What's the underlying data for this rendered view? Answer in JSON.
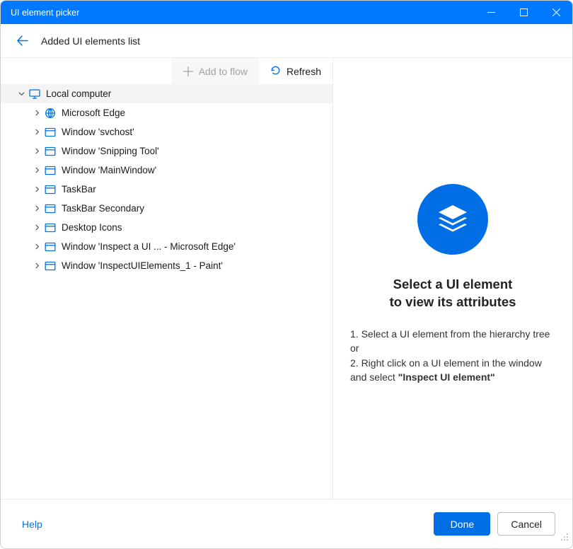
{
  "window": {
    "title": "UI element picker"
  },
  "header": {
    "title": "Added UI elements list"
  },
  "toolbar": {
    "add_label": "Add to flow",
    "refresh_label": "Refresh"
  },
  "tree": {
    "root_label": "Local computer",
    "items": [
      {
        "icon": "globe",
        "label": "Microsoft Edge"
      },
      {
        "icon": "window",
        "label": "Window 'svchost'"
      },
      {
        "icon": "window",
        "label": "Window 'Snipping Tool'"
      },
      {
        "icon": "window",
        "label": "Window 'MainWindow'"
      },
      {
        "icon": "window",
        "label": "TaskBar"
      },
      {
        "icon": "window",
        "label": "TaskBar Secondary"
      },
      {
        "icon": "window",
        "label": "Desktop Icons"
      },
      {
        "icon": "window",
        "label": "Window 'Inspect a UI  ...  - Microsoft Edge'"
      },
      {
        "icon": "window",
        "label": "Window 'InspectUIElements_1 - Paint'"
      }
    ]
  },
  "placeholder": {
    "title_line1": "Select a UI element",
    "title_line2": "to view its attributes",
    "step1": "1. Select a UI element from the hierarchy tree or",
    "step2_a": "2. Right click on a UI element in the window and select ",
    "step2_b": "\"Inspect UI element\""
  },
  "footer": {
    "help_label": "Help",
    "done_label": "Done",
    "cancel_label": "Cancel"
  }
}
